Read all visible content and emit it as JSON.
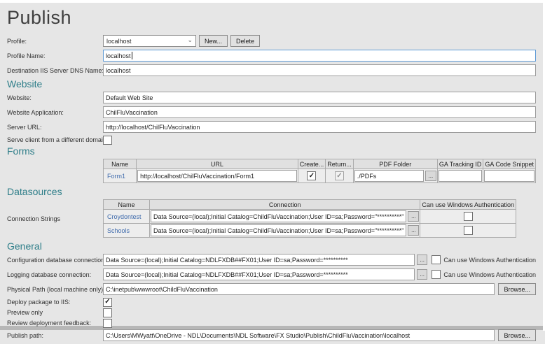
{
  "page": {
    "title": "Publish"
  },
  "icons": {
    "dropdown_chevron": "⌄"
  },
  "colors": {
    "section_header": "#2e7e89",
    "link": "#416cad",
    "focus_border": "#5f9bd5",
    "background": "#e6e6e6"
  },
  "profile": {
    "label": "Profile:",
    "value": "localhost",
    "new_button": "New...",
    "delete_button": "Delete"
  },
  "profile_name": {
    "label": "Profile Name:",
    "value": "localhost"
  },
  "destination_dns": {
    "label": "Destination IIS Server DNS Name:",
    "value": "localhost"
  },
  "website_section": {
    "title": "Website",
    "website": {
      "label": "Website:",
      "value": "Default Web Site"
    },
    "application": {
      "label": "Website Application:",
      "value": "ChilFluVaccination"
    },
    "server_url": {
      "label": "Server URL:",
      "value": "http://localhost/ChilFluVaccination"
    },
    "serve_client": {
      "label": "Serve client from a different domain:",
      "checked": false
    }
  },
  "forms_section": {
    "title": "Forms",
    "ellipsis_button": "...",
    "table": {
      "headers": [
        "Name",
        "URL",
        "Create...",
        "Return...",
        "PDF Folder",
        "GA Tracking ID",
        "GA Code Snippet"
      ],
      "rows": [
        {
          "name": "Form1",
          "url": "http://localhost/ChilFluVaccination/Form1",
          "create": true,
          "return": true,
          "pdf_folder": "./PDFs",
          "ga_tracking_id": "",
          "ga_code_snippet": ""
        }
      ]
    }
  },
  "datasources_section": {
    "title": "Datasources",
    "connection_strings_label": "Connection Strings",
    "ellipsis_button": "...",
    "table": {
      "headers": [
        "Name",
        "Connection",
        "Can use Windows Authentication"
      ],
      "rows": [
        {
          "name": "Croydontest",
          "connection": "Data Source=(local);Initial Catalog=ChildFluVaccination;User ID=sa;Password=\"**********\"",
          "windows_auth": false
        },
        {
          "name": "Schools",
          "connection": "Data Source=(local);Initial Catalog=ChildFluVaccination;User ID=sa;Password=\"**********\"",
          "windows_auth": false
        }
      ]
    }
  },
  "general_section": {
    "title": "General",
    "ellipsis_button": "...",
    "config_db": {
      "label": "Configuration database connection:",
      "value": "Data Source=(local);Initial Catalog=NDLFXDB##FX01;User ID=sa;Password=**********",
      "auth_label": "Can use Windows Authentication",
      "auth_checked": false
    },
    "logging_db": {
      "label": "Logging database connection:",
      "value": "Data Source=(local);Initial Catalog=NDLFXDB##FX01;User ID=sa;Password=**********",
      "auth_label": "Can use Windows Authentication",
      "auth_checked": false
    },
    "physical_path": {
      "label": "Physical Path (local machine only):",
      "value": "C:\\inetpub\\wwwroot\\ChildFluVaccination",
      "browse_button": "Browse..."
    },
    "deploy": {
      "label": "Deploy package to IIS:",
      "checked": true
    },
    "preview": {
      "label": "Preview only",
      "checked": false
    },
    "review": {
      "label": "Review deployment feedback:",
      "checked": false
    },
    "publish_path": {
      "label": "Publish path:",
      "value": "C:\\Users\\MWyatt\\OneDrive - NDL\\Documents\\NDL Software\\FX Studio\\Publish\\ChildFluVaccination\\localhost",
      "browse_button": "Browse..."
    }
  }
}
